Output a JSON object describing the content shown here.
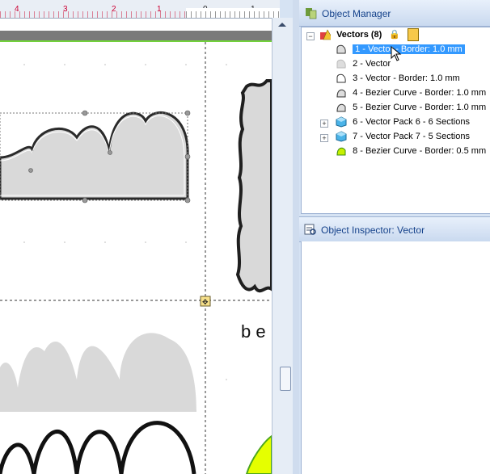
{
  "ruler": {
    "labels": [
      "4",
      "3",
      "2",
      "1",
      "0",
      "1"
    ]
  },
  "canvas": {
    "text_fragment": "b e"
  },
  "object_manager": {
    "title": "Object Manager",
    "root": {
      "label": "Vectors (8)"
    },
    "items": [
      {
        "label": "1 - Vector - Border: 1.0 mm",
        "selected": true,
        "icon": "vector-icon"
      },
      {
        "label": "2 - Vector",
        "selected": false,
        "icon": "vector-icon"
      },
      {
        "label": "3 - Vector - Border: 1.0 mm",
        "selected": false,
        "icon": "vector-icon"
      },
      {
        "label": "4 - Bezier Curve - Border: 1.0 mm",
        "selected": false,
        "icon": "bezier-icon"
      },
      {
        "label": "5 - Bezier Curve - Border: 1.0 mm",
        "selected": false,
        "icon": "bezier-icon"
      },
      {
        "label": "6 - Vector Pack 6 - 6 Sections",
        "selected": false,
        "icon": "vector-pack-icon"
      },
      {
        "label": "7 - Vector Pack 7 - 5 Sections",
        "selected": false,
        "icon": "vector-pack-icon"
      },
      {
        "label": "8 - Bezier Curve - Border: 0.5 mm",
        "selected": false,
        "icon": "bezier-green-icon"
      }
    ]
  },
  "object_inspector": {
    "title": "Object Inspector: Vector"
  },
  "colors": {
    "panel_header_text": "#15428b",
    "selection": "#3399ff",
    "shape_fill": "#d8d8d8",
    "accent_green": "#e5ff00"
  }
}
